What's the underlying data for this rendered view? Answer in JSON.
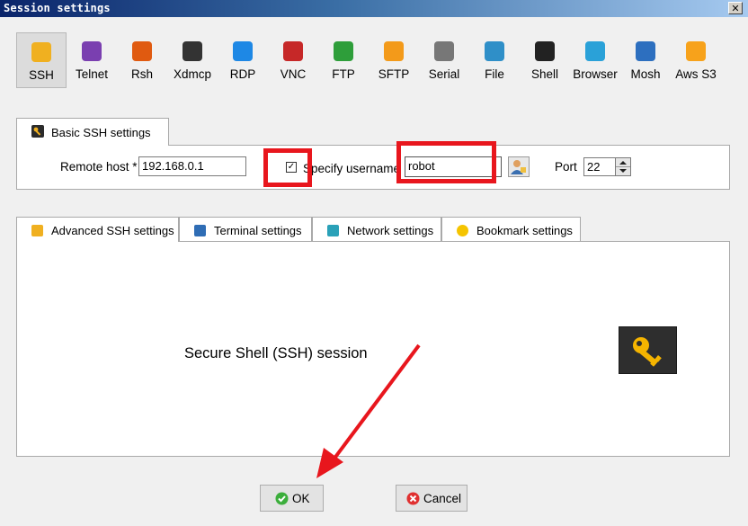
{
  "window": {
    "title": "Session settings",
    "close_glyph": "✕"
  },
  "session_types": [
    {
      "label": "SSH",
      "icon": "ssh-key-icon",
      "color": "#f0b020",
      "selected": true
    },
    {
      "label": "Telnet",
      "icon": "telnet-icon",
      "color": "#7a3fb0"
    },
    {
      "label": "Rsh",
      "icon": "rsh-icon",
      "color": "#e05a10"
    },
    {
      "label": "Xdmcp",
      "icon": "xdmcp-icon",
      "color": "#333333"
    },
    {
      "label": "RDP",
      "icon": "rdp-icon",
      "color": "#1e88e5"
    },
    {
      "label": "VNC",
      "icon": "vnc-icon",
      "color": "#c62828"
    },
    {
      "label": "FTP",
      "icon": "ftp-icon",
      "color": "#2e9e3a"
    },
    {
      "label": "SFTP",
      "icon": "sftp-icon",
      "color": "#f39a1a"
    },
    {
      "label": "Serial",
      "icon": "serial-icon",
      "color": "#777777"
    },
    {
      "label": "File",
      "icon": "file-icon",
      "color": "#2f8fc8"
    },
    {
      "label": "Shell",
      "icon": "shell-icon",
      "color": "#222222"
    },
    {
      "label": "Browser",
      "icon": "browser-icon",
      "color": "#2aa1d8"
    },
    {
      "label": "Mosh",
      "icon": "mosh-icon",
      "color": "#2d6fbf"
    },
    {
      "label": "Aws S3",
      "icon": "aws-s3-icon",
      "color": "#f7a21b"
    }
  ],
  "basic": {
    "tab_label": "Basic SSH settings",
    "remote_host_label": "Remote host *",
    "remote_host_value": "192.168.0.1",
    "specify_username_checked": true,
    "check_glyph": "✓",
    "specify_username_label": "Specify username",
    "username_value": "robot",
    "port_label": "Port",
    "port_value": "22"
  },
  "adv_tabs": [
    {
      "label": "Advanced SSH settings",
      "icon": "ssh-key-icon"
    },
    {
      "label": "Terminal settings",
      "icon": "terminal-icon"
    },
    {
      "label": "Network settings",
      "icon": "network-icon"
    },
    {
      "label": "Bookmark settings",
      "icon": "star-icon"
    }
  ],
  "main": {
    "description": "Secure Shell (SSH) session"
  },
  "buttons": {
    "ok": "OK",
    "cancel": "Cancel"
  },
  "annotation_color": "#e8161d"
}
